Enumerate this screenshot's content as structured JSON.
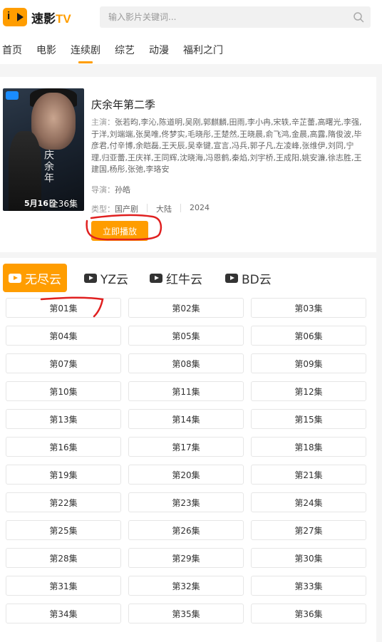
{
  "brand": {
    "name": "速影",
    "suffix": "TV"
  },
  "search": {
    "placeholder": "输入影片关键词..."
  },
  "nav": [
    {
      "label": "首页"
    },
    {
      "label": "电影"
    },
    {
      "label": "连续剧",
      "active": true
    },
    {
      "label": "综艺"
    },
    {
      "label": "动漫"
    },
    {
      "label": "福利之门"
    }
  ],
  "detail": {
    "title": "庆余年第二季",
    "cast_label": "主演：",
    "cast": "张若昀,李沁,陈道明,吴刚,郭麒麟,田雨,李小冉,宋轶,辛芷蕾,高曙光,李强,于洋,刘端端,张昊唯,佟梦实,毛晓彤,王楚然,王晓晨,俞飞鸿,金晨,高露,隋俊波,毕彦君,付辛博,余皑磊,王天辰,吴幸键,宣言,冯兵,郭子凡,左凌峰,张维伊,刘同,宁理,归亚蕾,王庆祥,王同辉,沈晓海,冯恩鹤,秦焰,刘宇桥,王成阳,姚安濂,徐志胜,王建国,杨彤,张弛,李珞安",
    "director_label": "导演：",
    "director": "孙皓",
    "type_label": "类型：",
    "genre": "国产剧",
    "region": "大陆",
    "year": "2024",
    "play_label": "立即播放",
    "poster": {
      "date_text": "5月16日",
      "episodes_text": "全36集",
      "calligraphy": "庆余年"
    }
  },
  "sources": [
    {
      "label": "无尽云",
      "active": true
    },
    {
      "label": "YZ云"
    },
    {
      "label": "红牛云"
    },
    {
      "label": "BD云"
    }
  ],
  "episodes": [
    "第01集",
    "第02集",
    "第03集",
    "第04集",
    "第05集",
    "第06集",
    "第07集",
    "第08集",
    "第09集",
    "第10集",
    "第11集",
    "第12集",
    "第13集",
    "第14集",
    "第15集",
    "第16集",
    "第17集",
    "第18集",
    "第19集",
    "第20集",
    "第21集",
    "第22集",
    "第23集",
    "第24集",
    "第25集",
    "第26集",
    "第27集",
    "第28集",
    "第29集",
    "第30集",
    "第31集",
    "第32集",
    "第33集",
    "第34集",
    "第35集",
    "第36集"
  ],
  "colors": {
    "accent": "#ff9d00",
    "annotation": "#e02020"
  }
}
